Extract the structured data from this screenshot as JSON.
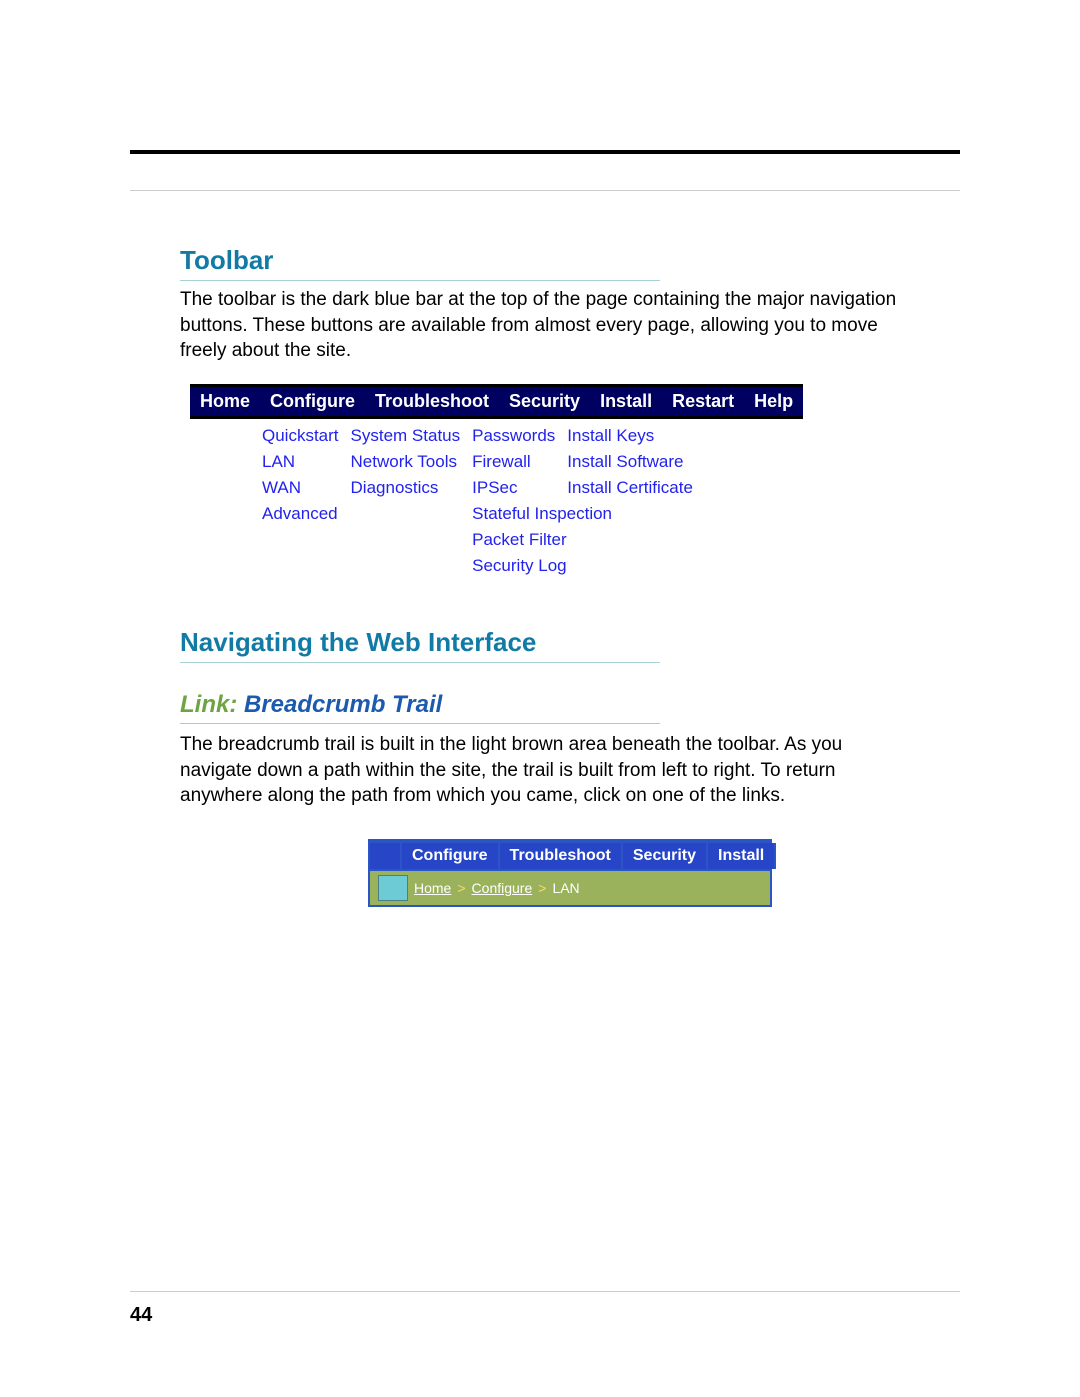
{
  "section1": {
    "title": "Toolbar",
    "para": "The toolbar is the dark blue bar at the top of the page containing the major navigation buttons. These buttons are available from almost every page, allowing you to move freely about the site."
  },
  "toolbar": {
    "headers": [
      "Home",
      "Configure",
      "Troubleshoot",
      "Security",
      "Install",
      "Restart",
      "Help"
    ],
    "columns": {
      "configure": [
        "Quickstart",
        "LAN",
        "WAN",
        "Advanced"
      ],
      "troubleshoot": [
        "System Status",
        "Network Tools",
        "Diagnostics"
      ],
      "security": [
        "Passwords",
        "Firewall",
        "IPSec",
        "Stateful Inspection",
        "Packet Filter",
        "Security Log"
      ],
      "install": [
        "Install Keys",
        "Install Software",
        "Install Certificate"
      ]
    }
  },
  "section2": {
    "title": "Navigating the Web Interface"
  },
  "linkHeader": {
    "prefix": "Link:",
    "title": "Breadcrumb Trail"
  },
  "breadcrumbPara": "The breadcrumb trail is built in the light brown area beneath the toolbar. As you navigate down a path within the site, the trail is built from left to right. To return anywhere along the path from which you came, click on one of the links.",
  "crumbFigure": {
    "tabs": [
      "Configure",
      "Troubleshoot",
      "Security",
      "Install"
    ],
    "trail": {
      "links": [
        "Home",
        "Configure"
      ],
      "current": "LAN",
      "sep": ">"
    }
  },
  "pageNumber": "44"
}
